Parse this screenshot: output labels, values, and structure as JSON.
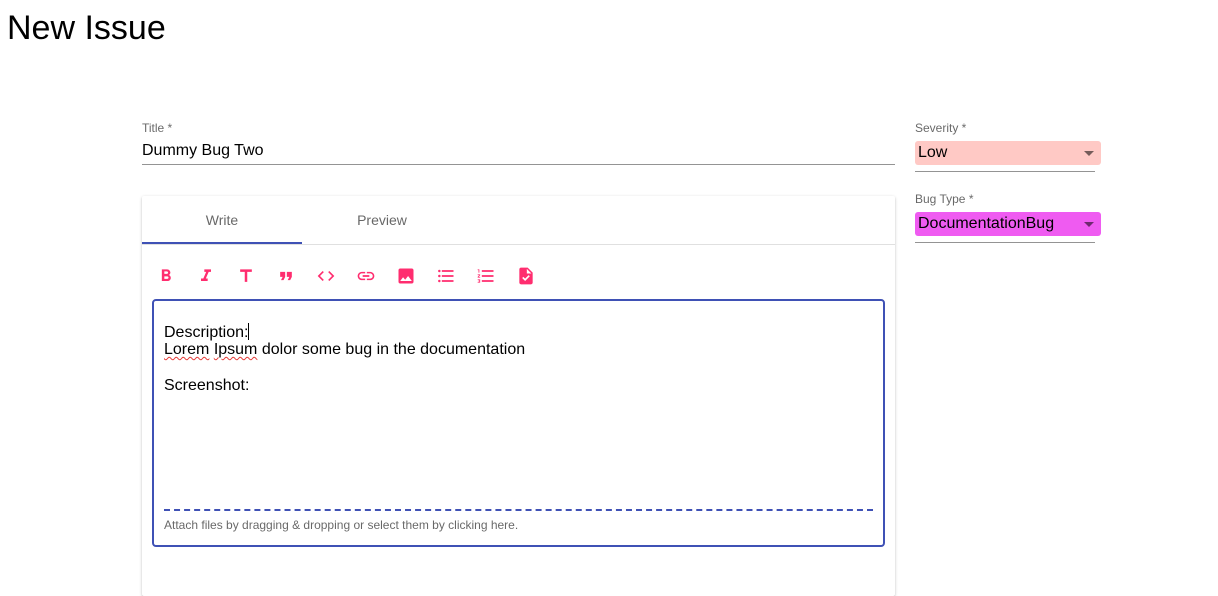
{
  "page": {
    "title": "New Issue"
  },
  "form": {
    "title_label": "Title *",
    "title_value": "Dummy Bug Two",
    "severity_label": "Severity *",
    "severity_value": "Low",
    "bug_type_label": "Bug Type *",
    "bug_type_value": "DocumentationBug"
  },
  "colors": {
    "severity_bg": "#ffc9c5",
    "bug_type_bg": "#ef5bf1",
    "accent": "#3f51b5",
    "toolbar_icon": "#ff2d6f"
  },
  "editor": {
    "tabs": [
      {
        "label": "Write"
      },
      {
        "label": "Preview"
      }
    ],
    "active_tab": "Write",
    "toolbar": [
      {
        "name": "bold-icon"
      },
      {
        "name": "italic-icon"
      },
      {
        "name": "header-icon"
      },
      {
        "name": "quote-icon"
      },
      {
        "name": "code-icon"
      },
      {
        "name": "link-icon"
      },
      {
        "name": "image-icon"
      },
      {
        "name": "unordered-list-icon"
      },
      {
        "name": "ordered-list-icon"
      },
      {
        "name": "checked-list-icon"
      }
    ],
    "content": {
      "line1": "Description:",
      "line2_misspelled_1": "Lorem",
      "line2_misspelled_2": "Ipsum",
      "line2_rest": " dolor some bug in the documentation",
      "line4": "Screenshot:"
    },
    "dropzone_text": "Attach files by dragging & dropping or select them by clicking here."
  }
}
